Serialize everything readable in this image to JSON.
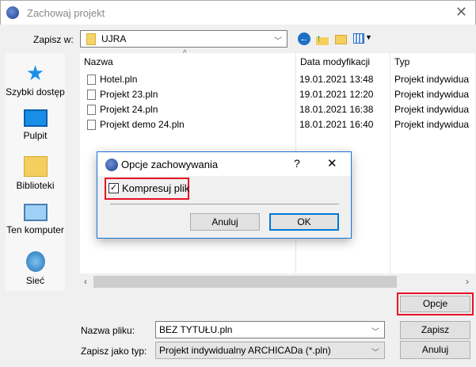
{
  "window": {
    "title": "Zachowaj projekt",
    "close": "✕"
  },
  "location": {
    "label": "Zapisz w:",
    "value": "UJRA"
  },
  "toolbar": {
    "icons": [
      "back-icon",
      "up-folder-icon",
      "new-folder-icon",
      "view-menu-icon"
    ]
  },
  "sidebar": {
    "items": [
      {
        "label": "Szybki dostęp"
      },
      {
        "label": "Pulpit"
      },
      {
        "label": "Biblioteki"
      },
      {
        "label": "Ten komputer"
      },
      {
        "label": "Sieć"
      }
    ]
  },
  "list": {
    "columns": [
      "Nazwa",
      "Data modyfikacji",
      "Typ"
    ],
    "rows": [
      {
        "name": "Hotel.pln",
        "date": "19.01.2021 13:48",
        "type": "Projekt indywidua"
      },
      {
        "name": "Projekt 23.pln",
        "date": "19.01.2021 12:20",
        "type": "Projekt indywidua"
      },
      {
        "name": "Projekt 24.pln",
        "date": "18.01.2021 16:38",
        "type": "Projekt indywidua"
      },
      {
        "name": "Projekt demo 24.pln",
        "date": "18.01.2021 16:40",
        "type": "Projekt indywidua"
      }
    ]
  },
  "form": {
    "filename_label": "Nazwa pliku:",
    "filename": "BEZ TYTUŁU.pln",
    "type_label": "Zapisz jako typ:",
    "type": "Projekt indywidualny ARCHICADa (*.pln)"
  },
  "buttons": {
    "options": "Opcje",
    "save": "Zapisz",
    "cancel": "Anuluj"
  },
  "dialog": {
    "title": "Opcje zachowywania",
    "help": "?",
    "close": "✕",
    "checkbox_label": "Kompresuj plik",
    "checked": true,
    "cancel": "Anuluj",
    "ok": "OK"
  },
  "colors": {
    "highlight": "#e81123",
    "accent": "#0078d7"
  }
}
